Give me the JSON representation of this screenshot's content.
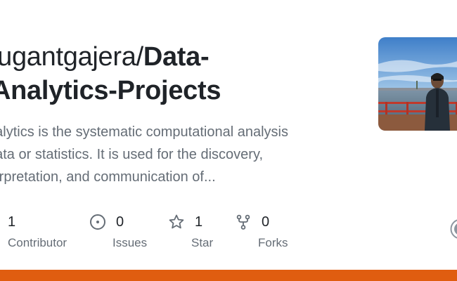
{
  "repo": {
    "owner": "jugantgajera/",
    "name": "Data-",
    "name_cont": "Analytics-Projects",
    "description_line1": "nalytics is the systematic computational analysis",
    "description_line2": "data or statistics. It is used for the discovery,",
    "description_line3": "terpretation, and communication of..."
  },
  "stats": {
    "contributors": {
      "value": "1",
      "label": "Contributor",
      "icon": "people-icon"
    },
    "issues": {
      "value": "0",
      "label": "Issues",
      "icon": "issue-icon"
    },
    "stars": {
      "value": "1",
      "label": "Star",
      "icon": "star-icon"
    },
    "forks": {
      "value": "0",
      "label": "Forks",
      "icon": "fork-icon"
    }
  },
  "colors": {
    "bottom_bar": "#e05d10",
    "title": "#1f2328",
    "muted": "#656d76"
  }
}
